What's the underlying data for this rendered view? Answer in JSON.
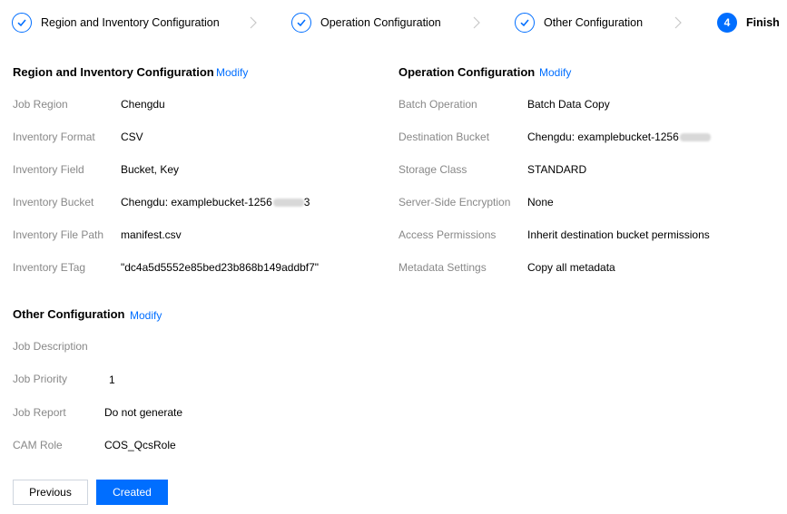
{
  "stepper": {
    "steps": [
      {
        "label": "Region and Inventory Configuration",
        "status": "done"
      },
      {
        "label": "Operation Configuration",
        "status": "done"
      },
      {
        "label": "Other Configuration",
        "status": "done"
      },
      {
        "number": "4",
        "label": "Finish",
        "status": "active"
      }
    ]
  },
  "region_section": {
    "title": "Region and Inventory Configuration",
    "modify": "Modify",
    "rows": [
      {
        "label": "Job Region",
        "value": "Chengdu"
      },
      {
        "label": "Inventory Format",
        "value": "CSV"
      },
      {
        "label": "Inventory Field",
        "value": "Bucket, Key"
      },
      {
        "label": "Inventory Bucket",
        "value": "Chengdu: examplebucket-1256",
        "value_tail": "3"
      },
      {
        "label": "Inventory File Path",
        "value": "manifest.csv"
      },
      {
        "label": "Inventory ETag",
        "value": "\"dc4a5d5552e85bed23b868b149addbf7\""
      }
    ]
  },
  "operation_section": {
    "title": "Operation Configuration",
    "modify": "Modify",
    "rows": [
      {
        "label": "Batch Operation",
        "value": "Batch Data Copy"
      },
      {
        "label": "Destination Bucket",
        "value": "Chengdu: examplebucket-1256"
      },
      {
        "label": "Storage Class",
        "value": "STANDARD"
      },
      {
        "label": "Server-Side Encryption",
        "value": "None"
      },
      {
        "label": "Access Permissions",
        "value": "Inherit destination bucket permissions"
      },
      {
        "label": "Metadata Settings",
        "value": "Copy all metadata"
      }
    ]
  },
  "other_section": {
    "title": "Other Configuration",
    "modify": "Modify",
    "rows": [
      {
        "label": "Job Description",
        "value": ""
      },
      {
        "label": "Job Priority",
        "value": "1"
      },
      {
        "label": "Job Report",
        "value": "Do not generate"
      },
      {
        "label": "CAM Role",
        "value": "COS_QcsRole"
      }
    ]
  },
  "buttons": {
    "previous": "Previous",
    "primary": "Created"
  },
  "colors": {
    "accent": "#006eff",
    "label_gray": "#888888"
  },
  "icons": {
    "step_done": "check-icon",
    "separator": "chevron-right-icon"
  }
}
